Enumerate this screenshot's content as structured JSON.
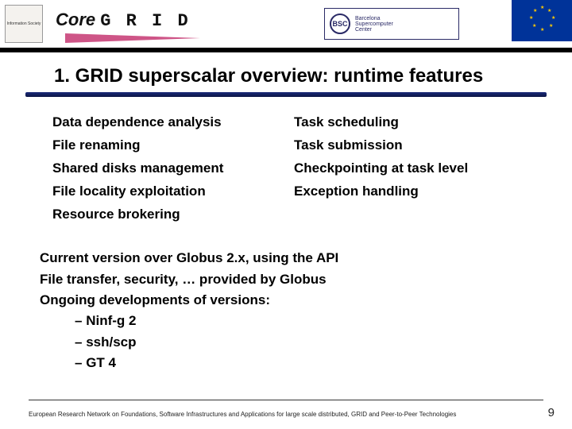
{
  "header": {
    "logo_left_text": "Information Society",
    "logo_core_core": "Core",
    "logo_core_grid": "G R I D",
    "bsc_abbrev": "BSC",
    "bsc_line1": "Barcelona",
    "bsc_line2": "Supercomputer",
    "bsc_line3": "Center"
  },
  "title": "1.  GRID superscalar overview: runtime features",
  "features_left": [
    "Data dependence analysis",
    "File renaming",
    "Shared disks management",
    "File locality exploitation",
    "Resource brokering"
  ],
  "features_right": [
    "Task scheduling",
    "Task submission",
    "Checkpointing at task level",
    "Exception handling"
  ],
  "lower_lines": [
    "Current version over Globus 2.x, using the API",
    "File transfer, security, … provided by Globus",
    "Ongoing developments of versions:"
  ],
  "sub_items": [
    "Ninf-g 2",
    "ssh/scp",
    "GT 4"
  ],
  "footer": "European Research Network on Foundations, Software Infrastructures and Applications for large scale distributed, GRID and Peer-to-Peer Technologies",
  "page_number": "9"
}
